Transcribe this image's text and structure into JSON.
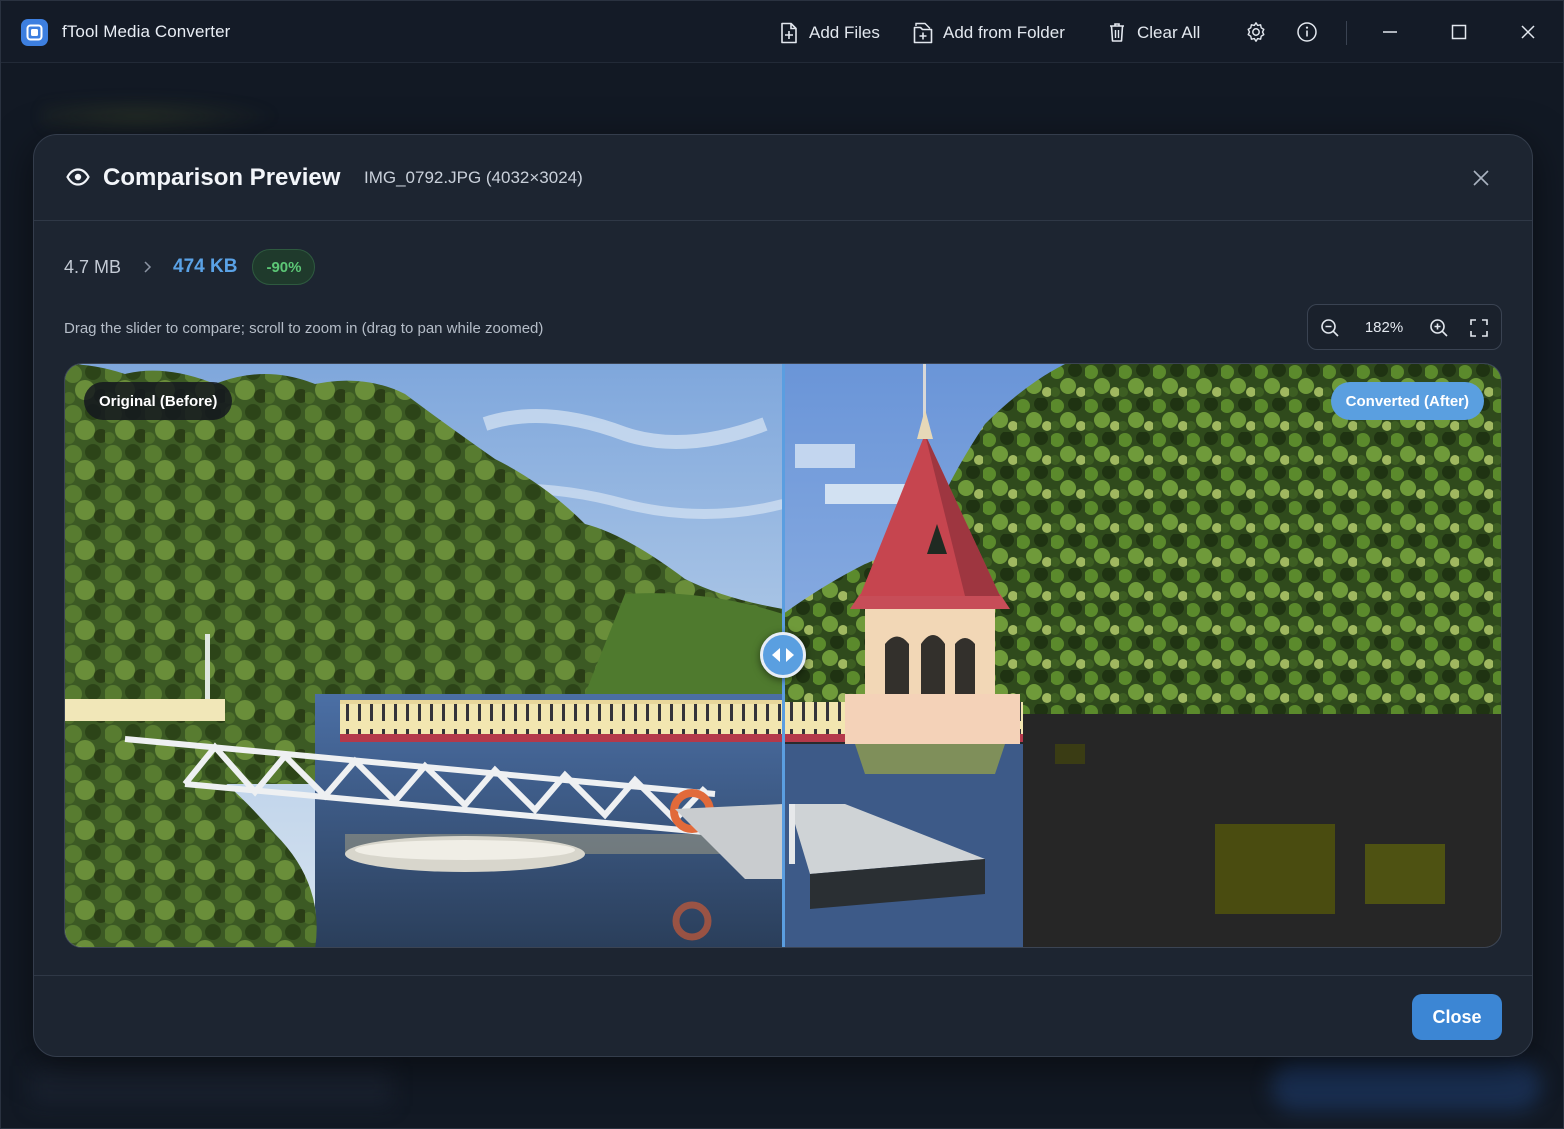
{
  "app": {
    "title": "fTool Media Converter"
  },
  "toolbar": {
    "add_files": "Add Files",
    "add_from_folder": "Add from Folder",
    "clear_all": "Clear All"
  },
  "dialog": {
    "title": "Comparison Preview",
    "file_info": "IMG_0792.JPG (4032×3024)",
    "original_size": "4.7 MB",
    "converted_size": "474 KB",
    "reduction_badge": "-90%",
    "hint": "Drag the slider to compare; scroll to zoom in (drag to pan while zoomed)",
    "zoom_level": "182%",
    "tag_before": "Original (Before)",
    "tag_after": "Converted (After)",
    "close_label": "Close"
  },
  "colors": {
    "accent": "#5a9fe0",
    "primary_button": "#3c86d4",
    "converted_size": "#5aa2e6",
    "badge_text": "#5cc776",
    "badge_bg": "#1f3a2c"
  },
  "icons": {
    "titlebar": [
      "app-logo-icon",
      "add-file-icon",
      "add-folder-icon",
      "trash-icon",
      "gear-icon",
      "info-icon",
      "minimize-icon",
      "maximize-icon",
      "close-icon"
    ],
    "dialog": [
      "eye-icon",
      "close-icon",
      "chevron-right-icon",
      "zoom-out-icon",
      "zoom-in-icon",
      "fullscreen-icon",
      "split-arrows-icon"
    ]
  }
}
